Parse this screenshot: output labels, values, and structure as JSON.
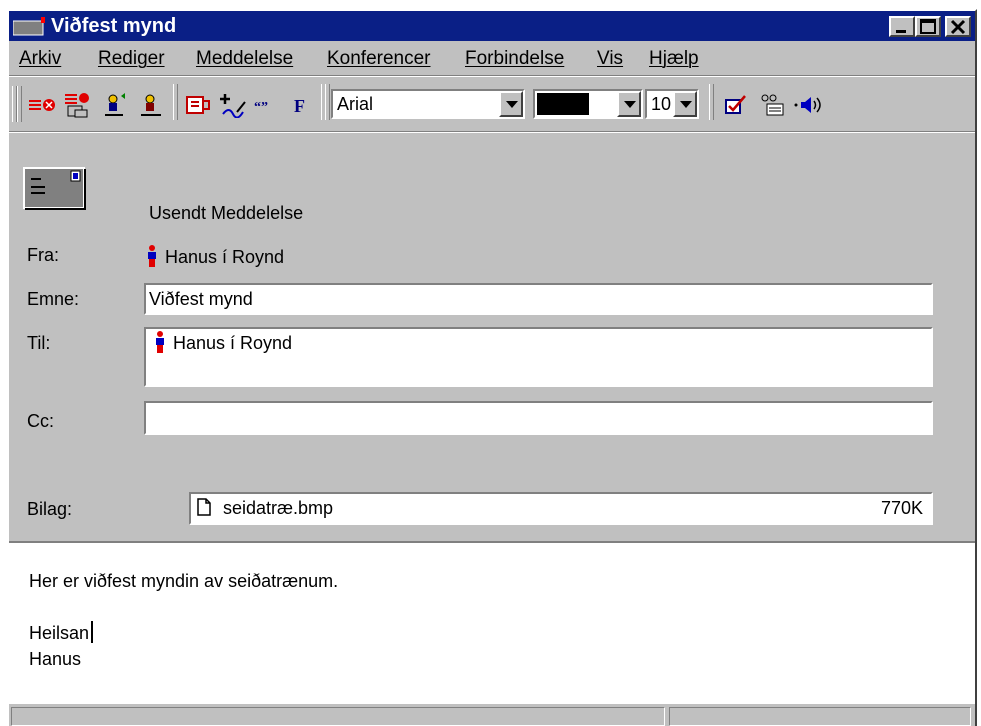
{
  "window": {
    "title": "Viðfest mynd"
  },
  "menu": [
    "Arkiv",
    "Rediger",
    "Meddelelse",
    "Konferencer",
    "Forbindelse",
    "Vis",
    "Hjælp"
  ],
  "toolbar": {
    "font": "Arial",
    "size": "10",
    "text_color": "#000000"
  },
  "header": {
    "status": "Usendt Meddelelse",
    "from_label": "Fra:",
    "from_value": "Hanus í Roynd",
    "subject_label": "Emne:",
    "subject_value": "Viðfest mynd",
    "to_label": "Til:",
    "to_value": "Hanus í Roynd",
    "cc_label": "Cc:",
    "cc_value": "",
    "attach_label": "Bilag:",
    "attach_name": "seidatræ.bmp",
    "attach_size": "770K"
  },
  "body": {
    "line1": "Her er viðfest myndin av seiðatrænum.",
    "line2": "Heilsan",
    "line3": "Hanus"
  },
  "icons": [
    "send-icon",
    "cancel-icon",
    "check-names-icon",
    "address-book-icon",
    "attach-icon",
    "signature-icon",
    "quote-icon",
    "bold-icon",
    "spell-check-icon",
    "properties-icon",
    "audio-icon",
    "message-icon",
    "person-icon",
    "file-icon"
  ],
  "colors": {
    "title_bar": "#0a1f86",
    "face": "#c0c0c0"
  }
}
